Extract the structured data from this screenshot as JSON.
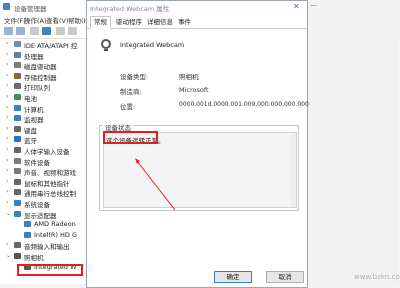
{
  "device_manager": {
    "title": "设备管理器",
    "menu": [
      "文件(F)",
      "操作(A)",
      "查看(V)",
      "帮助(H)"
    ],
    "tree": [
      {
        "arrow": "›",
        "label": "IDE ATA/ATAPI 控",
        "indent": 0,
        "color": "#6b8fb5"
      },
      {
        "arrow": "›",
        "label": "处理器",
        "indent": 0,
        "color": "#5a7fa8"
      },
      {
        "arrow": "›",
        "label": "磁盘驱动器",
        "indent": 0,
        "color": "#7a7a7a"
      },
      {
        "arrow": "›",
        "label": "存储控制器",
        "indent": 0,
        "color": "#8a6a3a"
      },
      {
        "arrow": "›",
        "label": "打印队列",
        "indent": 0,
        "color": "#6a6a6a"
      },
      {
        "arrow": "›",
        "label": "电池",
        "indent": 0,
        "color": "#4a8a4a"
      },
      {
        "arrow": "›",
        "label": "计算机",
        "indent": 0,
        "color": "#3f7fbf"
      },
      {
        "arrow": "›",
        "label": "监视器",
        "indent": 0,
        "color": "#3f7fbf"
      },
      {
        "arrow": "›",
        "label": "键盘",
        "indent": 0,
        "color": "#666666"
      },
      {
        "arrow": "›",
        "label": "蓝牙",
        "indent": 0,
        "color": "#2a6fd0"
      },
      {
        "arrow": "›",
        "label": "人体学输入设备",
        "indent": 0,
        "color": "#666666"
      },
      {
        "arrow": "›",
        "label": "软件设备",
        "indent": 0,
        "color": "#7a7a7a"
      },
      {
        "arrow": "›",
        "label": "声音、视频和游戏",
        "indent": 0,
        "color": "#7a7a7a"
      },
      {
        "arrow": "›",
        "label": "鼠标和其他指针",
        "indent": 0,
        "color": "#666666"
      },
      {
        "arrow": "›",
        "label": "通用串行总线控制",
        "indent": 0,
        "color": "#666666"
      },
      {
        "arrow": "›",
        "label": "系统设备",
        "indent": 0,
        "color": "#3f7fbf"
      },
      {
        "arrow": "⌄",
        "label": "显示适配器",
        "indent": 0,
        "color": "#3f7fbf"
      },
      {
        "arrow": "",
        "label": "AMD Radeon",
        "indent": 1,
        "color": "#3f7fbf"
      },
      {
        "arrow": "",
        "label": "Intel(R) HD G",
        "indent": 1,
        "color": "#3f7fbf"
      },
      {
        "arrow": "›",
        "label": "音频输入和输出",
        "indent": 0,
        "color": "#666666"
      },
      {
        "arrow": "⌄",
        "label": "照相机",
        "indent": 0,
        "color": "#555555"
      },
      {
        "arrow": "",
        "label": "Integrated W",
        "indent": 1,
        "color": "#555555"
      }
    ]
  },
  "dialog": {
    "title": "Integrated Webcam 属性",
    "tabs": [
      "常规",
      "驱动程序",
      "详细信息",
      "事件"
    ],
    "device_name": "Integrated Webcam",
    "props": [
      {
        "key": "设备类型:",
        "value": "照相机"
      },
      {
        "key": "制造商:",
        "value": "Microsoft"
      },
      {
        "key": "位置:",
        "value": "0000.001d.0000.001.009.000.000.000.000"
      }
    ],
    "status_legend": "设备状态",
    "status_text": "这个设备运转正常。",
    "ok_label": "确定",
    "cancel_label": "取消"
  },
  "watermark": "www.bzkn.com",
  "highlight_color": "#e02020"
}
